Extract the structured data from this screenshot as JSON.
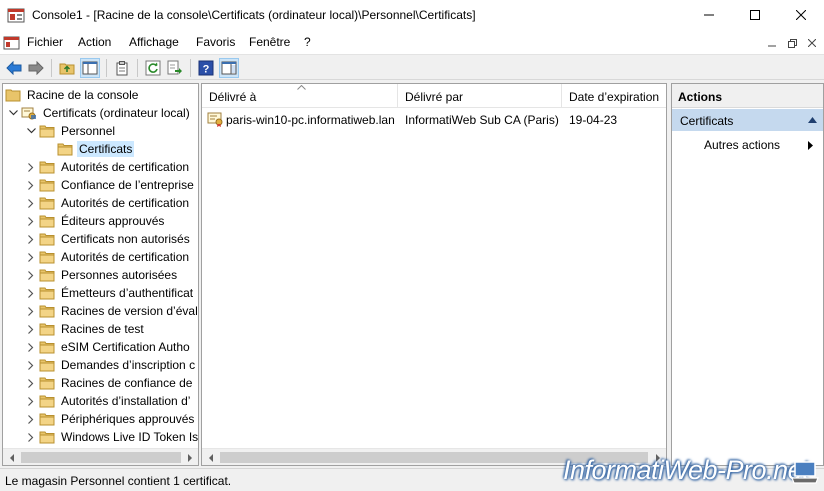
{
  "window": {
    "title": "Console1 - [Racine de la console\\Certificats (ordinateur local)\\Personnel\\Certificats]"
  },
  "menu": {
    "items": [
      "Fichier",
      "Action",
      "Affichage",
      "Favoris",
      "Fenêtre",
      "?"
    ]
  },
  "tree": {
    "items": [
      {
        "label": "Racine de la console",
        "level": 0,
        "icon": "console-root-icon"
      },
      {
        "label": "Certificats (ordinateur local)",
        "level": 1,
        "icon": "certificates-snapin-icon",
        "expanded": true
      },
      {
        "label": "Personnel",
        "level": 2,
        "icon": "folder-open-icon",
        "expanded": true
      },
      {
        "label": "Certificats",
        "level": 3,
        "icon": "folder-open-icon",
        "selected": true
      },
      {
        "label": "Autorités de certification",
        "level": 2,
        "icon": "folder-icon"
      },
      {
        "label": "Confiance de l’entreprise",
        "level": 2,
        "icon": "folder-icon"
      },
      {
        "label": "Autorités de certification",
        "level": 2,
        "icon": "folder-icon"
      },
      {
        "label": "Éditeurs approuvés",
        "level": 2,
        "icon": "folder-icon"
      },
      {
        "label": "Certificats non autorisés",
        "level": 2,
        "icon": "folder-icon"
      },
      {
        "label": "Autorités de certification",
        "level": 2,
        "icon": "folder-icon"
      },
      {
        "label": "Personnes autorisées",
        "level": 2,
        "icon": "folder-icon"
      },
      {
        "label": "Émetteurs d’authentificat",
        "level": 2,
        "icon": "folder-icon"
      },
      {
        "label": "Racines de version d’éval",
        "level": 2,
        "icon": "folder-icon"
      },
      {
        "label": "Racines de test",
        "level": 2,
        "icon": "folder-icon"
      },
      {
        "label": "eSIM Certification Autho",
        "level": 2,
        "icon": "folder-icon"
      },
      {
        "label": "Demandes d’inscription c",
        "level": 2,
        "icon": "folder-icon"
      },
      {
        "label": "Racines de confiance de",
        "level": 2,
        "icon": "folder-icon"
      },
      {
        "label": "Autorités d’installation d’",
        "level": 2,
        "icon": "folder-icon"
      },
      {
        "label": "Périphériques approuvés",
        "level": 2,
        "icon": "folder-icon"
      },
      {
        "label": "Windows Live ID Token Is",
        "level": 2,
        "icon": "folder-icon"
      }
    ]
  },
  "list": {
    "columns": [
      "Délivré à",
      "Délivré par",
      "Date d’expiration"
    ],
    "rows": [
      {
        "issued_to": "paris-win10-pc.informatiweb.lan",
        "issued_by": "InformatiWeb Sub CA (Paris)",
        "expiration": "19-04-23"
      }
    ]
  },
  "actions": {
    "title": "Actions",
    "section": "Certificats",
    "items": [
      "Autres actions"
    ]
  },
  "status": {
    "text": "Le magasin Personnel contient 1 certificat."
  },
  "watermark": {
    "text": "InformatiWeb-Pro.net"
  },
  "colors": {
    "selection": "#cce8ff",
    "actions_header": "#c5d9ee",
    "folder": "#e8c46a"
  }
}
